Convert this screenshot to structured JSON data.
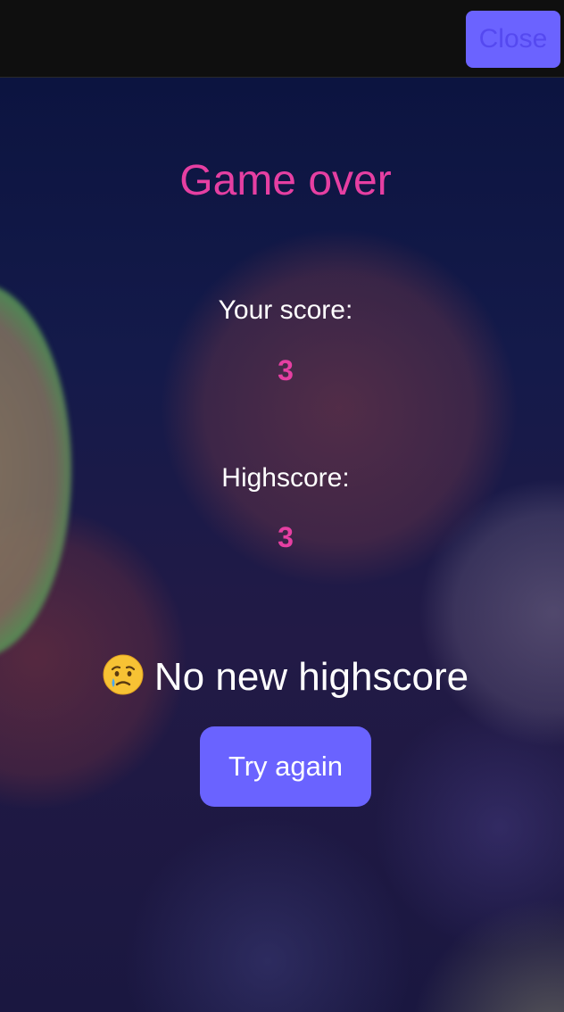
{
  "header": {
    "close_label": "Close"
  },
  "game_over": {
    "title": "Game over",
    "score_label": "Your score:",
    "score_value": "3",
    "highscore_label": "Highscore:",
    "highscore_value": "3",
    "result_emoji": "😢",
    "result_text": "No new highscore",
    "try_again_label": "Try again"
  },
  "colors": {
    "accent_pink": "#e63fa2",
    "button_purple": "#6a63ff",
    "top_bar": "#0f0f0f"
  },
  "icons": {
    "result_icon": "crying-face-icon"
  }
}
